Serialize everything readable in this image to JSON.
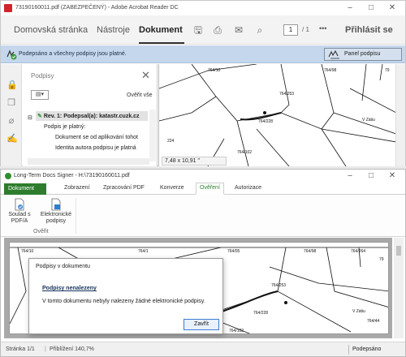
{
  "acrobat": {
    "title": "73190160011.pdf (ZABEZPEČENÝ) - Adobe Acrobat Reader DC",
    "menu": {
      "home": "Domovská stránka",
      "tools": "Nástroje",
      "document": "Dokument",
      "signin": "Přihlásit se"
    },
    "page": {
      "current": "1",
      "total": "/ 1"
    },
    "more": "•••",
    "sigbar": {
      "message": "Podepsáno a všechny podpisy jsou platné.",
      "panel_button": "Panel podpisu"
    },
    "sigpanel": {
      "title": "Podpisy",
      "verify_all": "Ověřit vše",
      "options_label": "▤▾",
      "tree": [
        "Rev. 1: Podepsal(a): katastr.cuzk.cz",
        "Podpis je platný:",
        "Dokument se od aplikování tohot",
        "Identita autora podpisu je platná"
      ]
    },
    "map_labels": {
      "a": "764/10",
      "b": "764/98",
      "c": "764/253",
      "d": "764/228",
      "e": "764/102",
      "f": "V Zátiu",
      "g": "224",
      "h": "764/1",
      "i": "764/05",
      "j": "764/264",
      "k": "764/44",
      "l": "79"
    },
    "page_size": "7,48 x 10,91 \""
  },
  "signer": {
    "title": "Long-Term Docs Signer - H:\\73190160011.pdf",
    "tabs": [
      "Dokument",
      "Zobrazení",
      "Zpracování PDF",
      "Konverze",
      "Ověření",
      "Autorizace"
    ],
    "active_tab": "Ověření",
    "ribbon": {
      "btn1": "Soulad s\nPDF/A",
      "btn2": "Elektronické\npodpisy",
      "group": "Ověřit"
    },
    "dialog": {
      "title": "Podpisy v dokumentu",
      "heading": "Podpisy nenalezeny",
      "message": "V tomto dokumentu nebyly nalezeny žádné elektronické podpisy.",
      "button": "Zavřít"
    },
    "status": {
      "page": "Stránka 1/1",
      "zoom": "Přiblížení 140,7%",
      "signed": "Podepsáno"
    }
  },
  "colors": {
    "sigbar_bg": "#c4d7ec",
    "signer_accent": "#2d7d2d",
    "acrobat_red": "#d1232a"
  }
}
